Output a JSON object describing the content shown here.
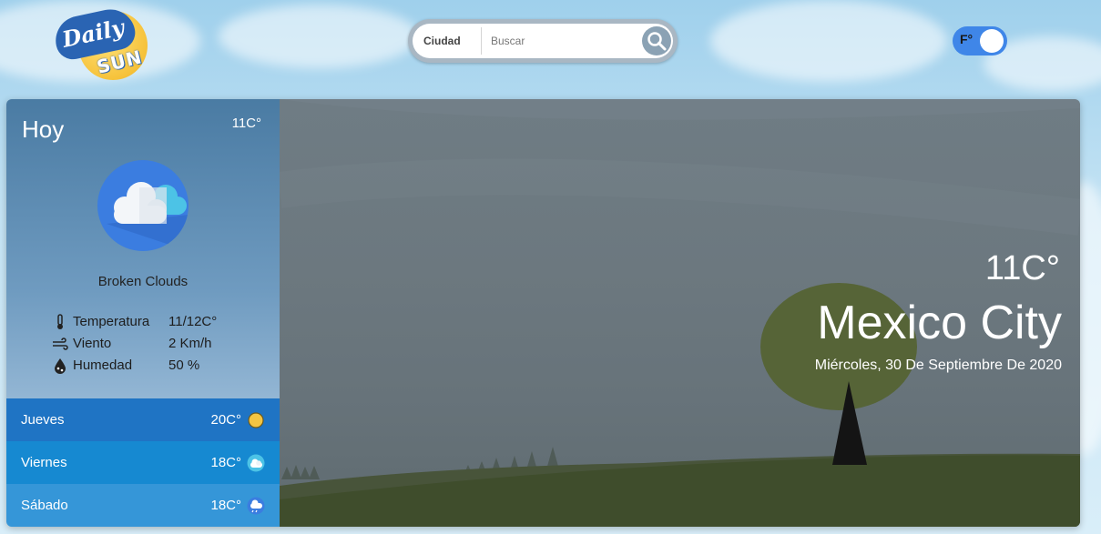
{
  "logo": {
    "word1": "Daily",
    "word2": "SUN"
  },
  "search": {
    "city_label": "Ciudad",
    "placeholder": "Buscar"
  },
  "unit_toggle": {
    "label": "F°"
  },
  "today": {
    "title": "Hoy",
    "temp": "11C°",
    "description": "Broken Clouds",
    "stats": [
      {
        "icon": "thermometer-icon",
        "label": "Temperatura",
        "value": "11/12C°"
      },
      {
        "icon": "wind-icon",
        "label": "Viento",
        "value": "2 Km/h"
      },
      {
        "icon": "humidity-icon",
        "label": "Humedad",
        "value": "50 %"
      }
    ]
  },
  "forecast": [
    {
      "day": "Jueves",
      "temp": "20C°",
      "icon": "sun-icon",
      "color": "#1f74c4"
    },
    {
      "day": "Viernes",
      "temp": "18C°",
      "icon": "cloud-icon",
      "color": "#1689d1"
    },
    {
      "day": "Sábado",
      "temp": "18C°",
      "icon": "rain-cloud-icon",
      "color": "#3596d8"
    }
  ],
  "hero": {
    "temp": "11C°",
    "city": "Mexico City",
    "date": "Miércoles, 30 De Septiembre De 2020"
  },
  "colors": {
    "toggle": "#3f86e8",
    "grass": "#3f4d2c",
    "tree_canopy": "#566437"
  }
}
